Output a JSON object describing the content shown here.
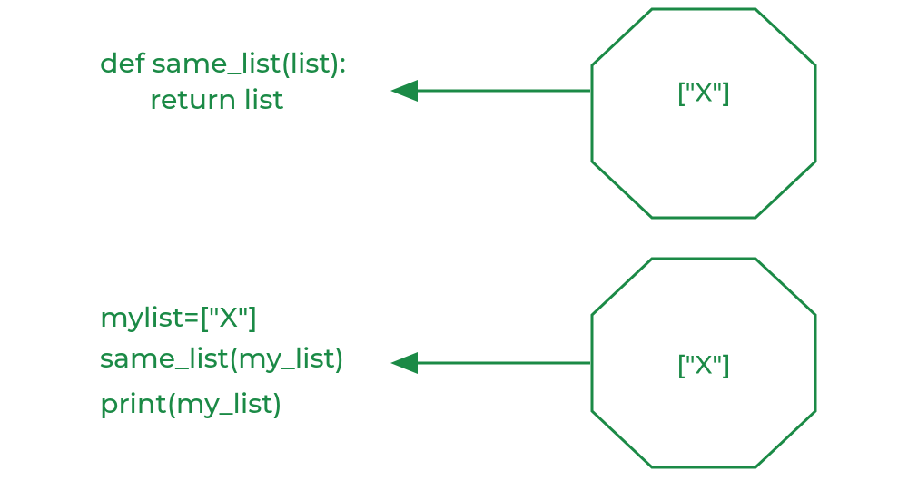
{
  "color": "#1b8a46",
  "diagram": {
    "top": {
      "code": {
        "line1": "def same_list(list):",
        "line2": "return list"
      },
      "node_label": "[\"X\"]"
    },
    "bottom": {
      "code": {
        "line1": "mylist=[\"X\"]",
        "line2": "same_list(my_list)",
        "line3": "print(my_list)"
      },
      "node_label": "[\"X\"]"
    }
  }
}
